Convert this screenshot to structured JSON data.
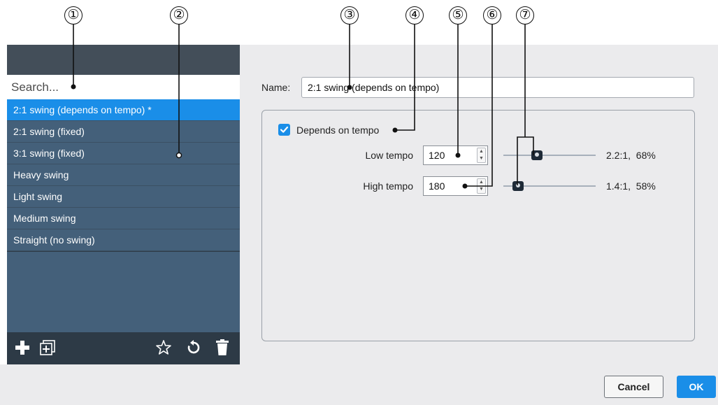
{
  "left_panel": {
    "search_placeholder": "Search...",
    "presets": [
      {
        "label": "2:1 swing (depends on tempo) *",
        "selected": true
      },
      {
        "label": "2:1 swing (fixed)",
        "selected": false
      },
      {
        "label": "3:1 swing (fixed)",
        "selected": false
      },
      {
        "label": "Heavy swing",
        "selected": false
      },
      {
        "label": "Light swing",
        "selected": false
      },
      {
        "label": "Medium swing",
        "selected": false
      },
      {
        "label": "Straight (no swing)",
        "selected": false
      }
    ],
    "toolbar": {
      "icons": [
        "plus-icon",
        "duplicate-icon",
        "star-icon",
        "reset-icon",
        "trash-icon"
      ]
    }
  },
  "editor": {
    "name_label": "Name:",
    "name_value": "2:1 swing (depends on tempo)",
    "depends_on_tempo": {
      "label": "Depends on tempo",
      "checked": true
    },
    "low_tempo": {
      "label": "Low tempo",
      "value": "120",
      "ratio_text": "2.2:1,  68%",
      "slider_percent": 68
    },
    "high_tempo": {
      "label": "High tempo",
      "value": "180",
      "ratio_text": "1.4:1,  58%",
      "slider_percent": 58
    }
  },
  "buttons": {
    "cancel": "Cancel",
    "ok": "OK"
  },
  "callouts": [
    "①",
    "②",
    "③",
    "④",
    "⑤",
    "⑥",
    "⑦"
  ],
  "colors": {
    "accent": "#1a8ee8",
    "list_bg": "#44607a",
    "panel_dark": "#2d3a46"
  }
}
